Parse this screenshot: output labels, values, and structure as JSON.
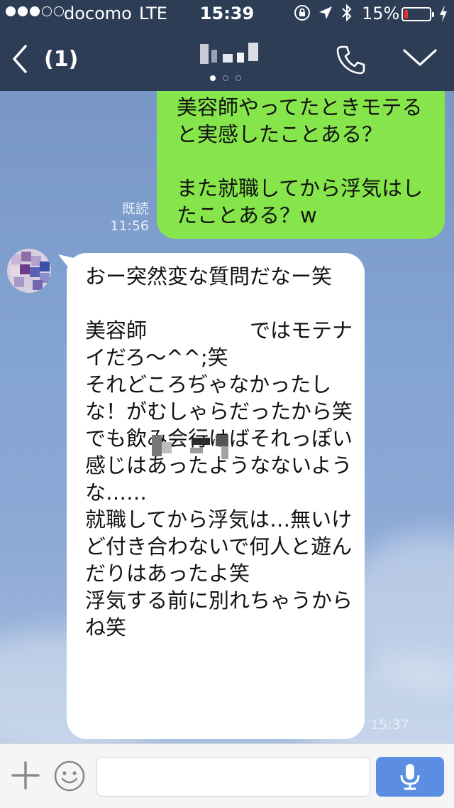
{
  "status_bar": {
    "carrier": "docomo",
    "network": "LTE",
    "time": "15:39",
    "battery_percent": "15%",
    "signal_bars": 3,
    "battery_level": 0.15,
    "icons": [
      "orientation-lock-icon",
      "location-arrow-icon",
      "bluetooth-icon",
      "battery-icon",
      "charging-bolt-icon"
    ]
  },
  "header": {
    "back_count": "(1)",
    "page_indicator": {
      "total": 3,
      "active": 1
    },
    "icons": [
      "back-chevron-icon",
      "phone-icon",
      "chevron-down-icon"
    ]
  },
  "messages": [
    {
      "side": "sent",
      "text": "美容師やってたときモテると実感したことある？\n\nまた就職してから浮気はしたことある？w",
      "read_label": "既読",
      "time": "11:56"
    },
    {
      "side": "received",
      "text": "おー突然変な質問だなー笑\n\n美容師　　　　　ではモテナイだろ〜^^;笑\nそれどころぢゃなかったしな！がむしゃらだったから笑\nでも飲み会行けばそれっぽい感じはあったようなないような……\n就職してから浮気は…無いけど付き合わないで何人と遊んだりはあったよ笑\n浮気する前に別れちゃうからね笑",
      "time": "15:37"
    }
  ],
  "input_bar": {
    "placeholder": "",
    "icons": [
      "plus-icon",
      "emoji-icon",
      "microphone-icon"
    ]
  },
  "colors": {
    "header_bg": "#2E3D56",
    "chat_bg": "#7F9FCB",
    "sent_bubble": "#86E54A",
    "received_bubble": "#FFFFFF",
    "mic_button": "#5B8EE2",
    "battery_low": "#E8322C"
  }
}
